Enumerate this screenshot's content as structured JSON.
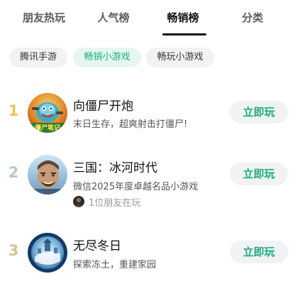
{
  "tabs": [
    {
      "label": "朋友热玩",
      "active": false
    },
    {
      "label": "人气榜",
      "active": false
    },
    {
      "label": "畅销榜",
      "active": true
    },
    {
      "label": "分类",
      "active": false
    }
  ],
  "chips": [
    {
      "label": "腾讯手游",
      "active": false
    },
    {
      "label": "畅销小游戏",
      "active": true
    },
    {
      "label": "畅玩小游戏",
      "active": false
    }
  ],
  "games": [
    {
      "rank": "1",
      "rank_color": "#e8c55a",
      "title": "向僵尸开炮",
      "description": "末日生存，超爽射击打僵尸!",
      "friends": "",
      "icon": "zombie-game-icon",
      "icon_caption": "僵尸笔记",
      "button": "立即玩"
    },
    {
      "rank": "2",
      "rank_color": "#b9c4cc",
      "title": "三国：冰河时代",
      "description": "微信2025年度卓越名品小游戏",
      "friends": "1位朋友在玩",
      "icon": "three-kingdoms-game-icon",
      "button": "立即玩"
    },
    {
      "rank": "3",
      "rank_color": "#d9bf9c",
      "title": "无尽冬日",
      "description": "探索冻土，重建家园",
      "friends": "",
      "icon": "endless-winter-game-icon",
      "button": "立即玩"
    }
  ],
  "colors": {
    "accent": "#1aad7e",
    "chip_bg": "#f1f2f4",
    "chip_active_bg": "#e6f7f1"
  }
}
